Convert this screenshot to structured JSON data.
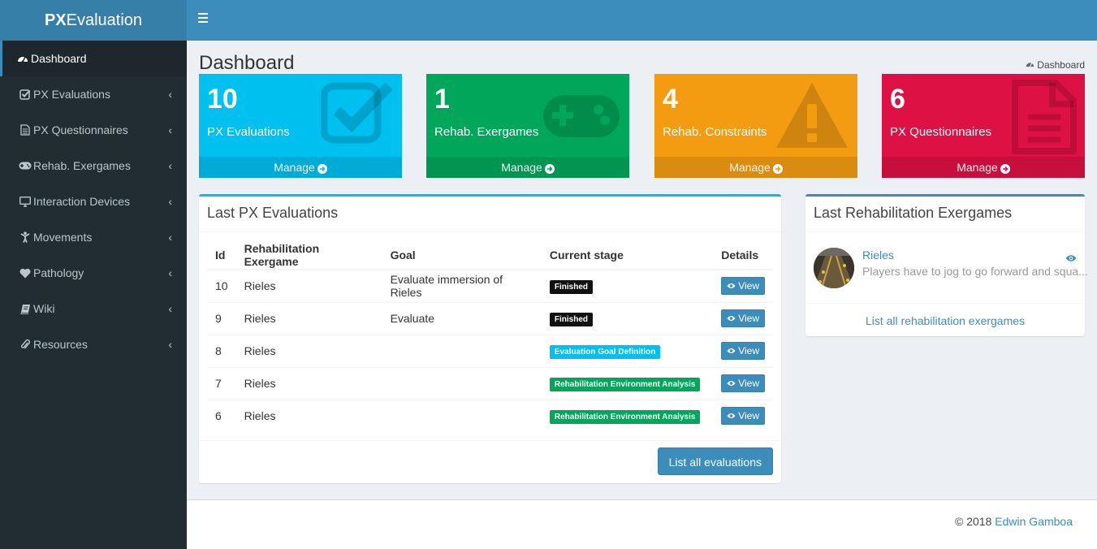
{
  "app": {
    "logo_bold": "PX",
    "logo_rest": "Evaluation"
  },
  "sidebar": {
    "items": [
      {
        "label": "Dashboard",
        "icon": "dashboard-icon",
        "active": true
      },
      {
        "label": "PX Evaluations",
        "icon": "check-square-icon"
      },
      {
        "label": "PX Questionnaires",
        "icon": "file-text-icon"
      },
      {
        "label": "Rehab. Exergames",
        "icon": "gamepad-icon"
      },
      {
        "label": "Interaction Devices",
        "icon": "desktop-icon"
      },
      {
        "label": "Movements",
        "icon": "child-icon"
      },
      {
        "label": "Pathology",
        "icon": "heart-icon"
      },
      {
        "label": "Wiki",
        "icon": "book-icon"
      },
      {
        "label": "Resources",
        "icon": "paperclip-icon"
      }
    ]
  },
  "header": {
    "page_title": "Dashboard",
    "breadcrumb": "Dashboard"
  },
  "stats": [
    {
      "value": "10",
      "label": "PX Evaluations",
      "footer": "Manage",
      "color": "#00c0ef",
      "icon": "check-square-icon"
    },
    {
      "value": "1",
      "label": "Rehab. Exergames",
      "footer": "Manage",
      "color": "#00a65a",
      "icon": "gamepad-icon"
    },
    {
      "value": "4",
      "label": "Rehab. Constraints",
      "footer": "Manage",
      "color": "#f39c12",
      "icon": "warning-icon"
    },
    {
      "value": "6",
      "label": "PX Questionnaires",
      "footer": "Manage",
      "color": "#dd1144",
      "icon": "file-text-icon"
    }
  ],
  "evaluations": {
    "title": "Last PX Evaluations",
    "columns": [
      "Id",
      "Rehabilitation Exergame",
      "Goal",
      "Current stage",
      "Details"
    ],
    "rows": [
      {
        "id": "10",
        "exergame": "Rieles",
        "goal": "Evaluate immersion of Rieles",
        "stage": "Finished",
        "stage_color": "#111111",
        "action": "View"
      },
      {
        "id": "9",
        "exergame": "Rieles",
        "goal": "Evaluate",
        "stage": "Finished",
        "stage_color": "#111111",
        "action": "View"
      },
      {
        "id": "8",
        "exergame": "Rieles",
        "goal": "",
        "stage": "Evaluation Goal Definition",
        "stage_color": "#00c0ef",
        "action": "View"
      },
      {
        "id": "7",
        "exergame": "Rieles",
        "goal": "",
        "stage": "Rehabilitation Environment Analysis",
        "stage_color": "#00a65a",
        "action": "View"
      },
      {
        "id": "6",
        "exergame": "Rieles",
        "goal": "",
        "stage": "Rehabilitation Environment Analysis",
        "stage_color": "#00a65a",
        "action": "View"
      }
    ],
    "list_all": "List all evaluations"
  },
  "exergames": {
    "title": "Last Rehabilitation Exergames",
    "item_name": "Rieles",
    "item_desc": "Players have to jog to go forward and squa...",
    "list_all": "List all rehabilitation exergames"
  },
  "footer": {
    "copyright": "© 2018",
    "author": "Edwin Gamboa"
  }
}
